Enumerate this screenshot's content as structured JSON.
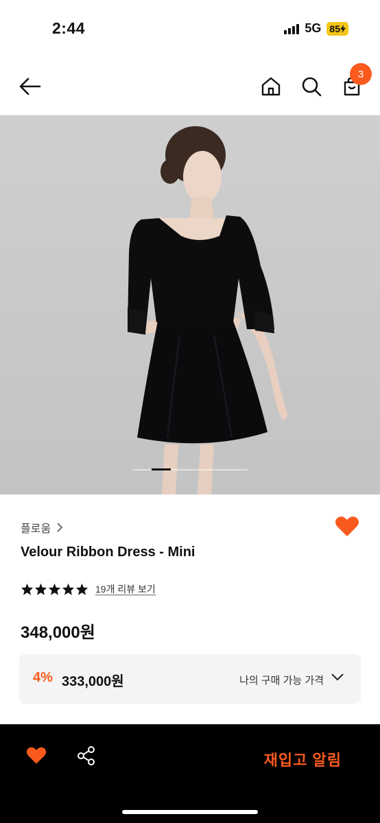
{
  "status_bar": {
    "time": "2:44",
    "network": "5G",
    "battery": "85"
  },
  "nav": {
    "cart_count": "3"
  },
  "product": {
    "brand": "플로움",
    "title": "Velour Ribbon Dress - Mini",
    "rating": 5,
    "review_link": "19개 리뷰 보기",
    "price": "348,000원"
  },
  "member_price": {
    "discount": "4%",
    "amount": "333,000원",
    "label": "나의 구매 가능 가격"
  },
  "bottom_bar": {
    "restock_label": "재입고 알림"
  },
  "colors": {
    "accent": "#fa5a1e",
    "bar": "#000000",
    "hero_bg": "#c9c9c9"
  },
  "gallery": {
    "current_index": 2,
    "total": 6
  }
}
